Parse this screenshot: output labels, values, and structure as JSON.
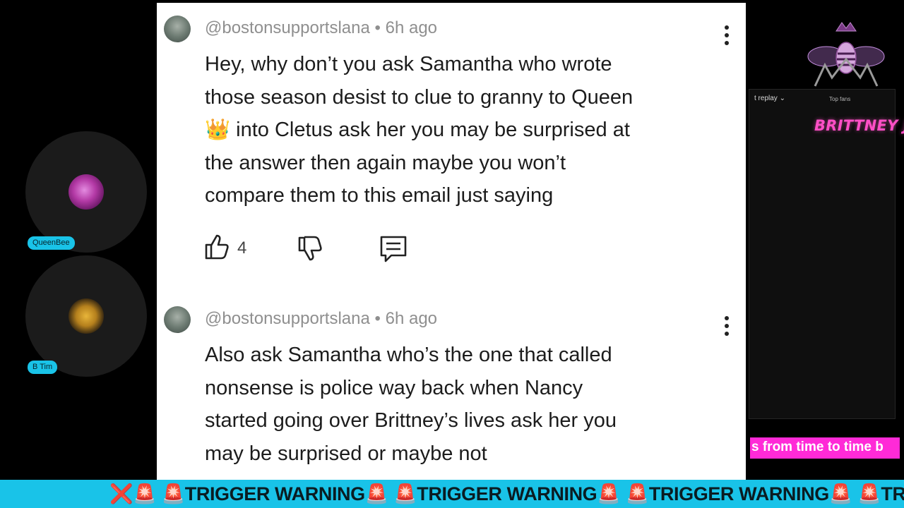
{
  "participants": [
    {
      "name": "QueenBee"
    },
    {
      "name": "B Tim"
    }
  ],
  "comments": [
    {
      "handle": "@bostonsupportslana",
      "time": "6h ago",
      "text_line1": "Hey, why don’t you ask Samantha who wrote",
      "text_line2": "those season desist to clue to granny to Queen",
      "text_line3": "👑 into Cletus ask her you may be surprised at",
      "text_line4": "the answer then again maybe you won’t",
      "text_line5": "compare them to this email just saying",
      "likes": "4"
    },
    {
      "handle": "@bostonsupportslana",
      "time": "6h ago",
      "text_line1": "Also ask Samantha who’s the one that called",
      "text_line2": "nonsense is police way back when Nancy",
      "text_line3": "started going over Brittney’s lives ask her you",
      "text_line4": "may be surprised or maybe not"
    }
  ],
  "overlay": {
    "replay_label": "t replay",
    "top_fans_label": "Top fans",
    "brand": "BRITTNEY J",
    "pink_ticker": "s from time to time b"
  },
  "ticker": {
    "text": "❌🚨 🚨TRIGGER WARNING🚨 🚨TRIGGER WARNING🚨 🚨TRIGGER WARNING🚨 🚨TRIGGE"
  },
  "colors": {
    "ticker_bg": "#19c3e8",
    "pink_accent": "#ff2ad7",
    "brand_text": "#ff4fc6"
  },
  "icons": [
    "thumbs-up-icon",
    "thumbs-down-icon",
    "reply-icon",
    "more-vertical-icon",
    "bee-crown-logo-icon"
  ]
}
